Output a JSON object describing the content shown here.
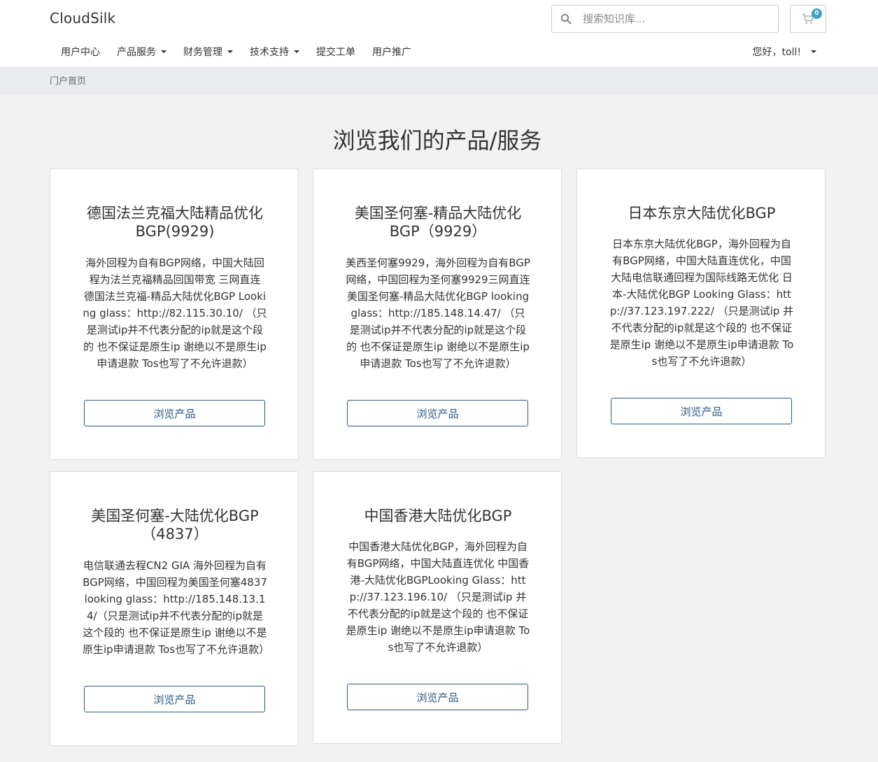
{
  "header": {
    "brand": "CloudSilk",
    "search_placeholder": "搜索知识库...",
    "cart_count": "0"
  },
  "nav": {
    "items": [
      {
        "label": "用户中心",
        "dropdown": false
      },
      {
        "label": "产品服务",
        "dropdown": true
      },
      {
        "label": "财务管理",
        "dropdown": true
      },
      {
        "label": "技术支持",
        "dropdown": true
      },
      {
        "label": "提交工单",
        "dropdown": false
      },
      {
        "label": "用户推广",
        "dropdown": false
      }
    ],
    "user_greeting": "您好，toll!"
  },
  "breadcrumb": "门户首页",
  "page_title": "浏览我们的产品/服务",
  "products": [
    {
      "title": "德国法兰克福大陆精品优化BGP(9929)",
      "description": "海外回程为自有BGP网络，中国大陆回程为法兰克福精品回国带宽 三网直连 德国法兰克福-精品大陆优化BGP Looking glass：http://82.115.30.10/ （只是测试ip并不代表分配的ip就是这个段的 也不保证是原生ip 谢绝以不是原生ip申请退款 Tos也写了不允许退款）",
      "button": "浏览产品"
    },
    {
      "title": "美国圣何塞-精品大陆优化BGP（9929）",
      "description": "美西圣何塞9929，海外回程为自有BGP网络，中国回程为圣何塞9929三网直连 美国圣何塞-精品大陆优化BGP looking glass：http://185.148.14.47/ （只是测试ip并不代表分配的ip就是这个段的 也不保证是原生ip 谢绝以不是原生ip申请退款 Tos也写了不允许退款）",
      "button": "浏览产品"
    },
    {
      "title": "日本东京大陆优化BGP",
      "description": "日本东京大陆优化BGP，海外回程为自有BGP网络，中国大陆直连优化，中国大陆电信联通回程为国际线路无优化 日本-大陆优化BGP Looking Glass：http://37.123.197.222/ （只是测试ip 并不代表分配的ip就是这个段的 也不保证是原生ip 谢绝以不是原生ip申请退款 Tos也写了不允许退款）",
      "button": "浏览产品"
    },
    {
      "title": "美国圣何塞-大陆优化BGP（4837）",
      "description": "电信联通去程CN2 GIA 海外回程为自有BGP网络，中国回程为美国圣何塞4837 looking glass：http://185.148.13.14/（只是测试ip并不代表分配的ip就是这个段的 也不保证是原生ip 谢绝以不是原生ip申请退款 Tos也写了不允许退款）",
      "button": "浏览产品"
    },
    {
      "title": "中国香港大陆优化BGP",
      "description": "中国香港大陆优化BGP，海外回程为自有BGP网络，中国大陆直连优化 中国香港-大陆优化BGPLooking Glass：http://37.123.196.10/ （只是测试ip 并不代表分配的ip就是这个段的 也不保证是原生ip 谢绝以不是原生ip申请退款 Tos也写了不允许退款）",
      "button": "浏览产品"
    }
  ]
}
